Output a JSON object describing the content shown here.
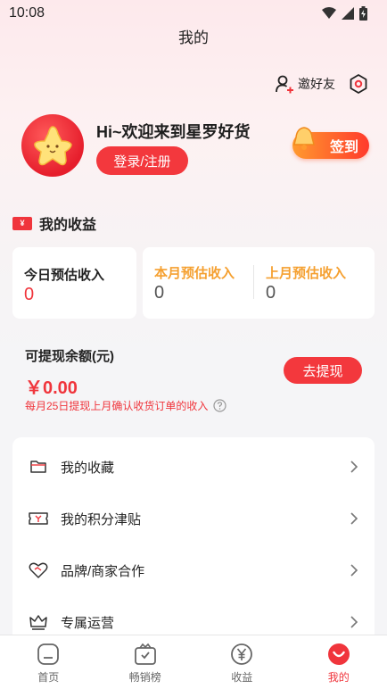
{
  "status_bar": {
    "time": "10:08"
  },
  "header": {
    "title": "我的",
    "invite_label": "邀好友"
  },
  "profile": {
    "greeting": "Hi~欢迎来到星罗好货",
    "login_label": "登录/注册",
    "signin_label": "签到"
  },
  "earnings": {
    "section_title": "我的收益",
    "badge_text": "¥",
    "today": {
      "label": "今日预估收入",
      "value": "0"
    },
    "this_month": {
      "label": "本月预估收入",
      "value": "0"
    },
    "last_month": {
      "label": "上月预估收入",
      "value": "0"
    }
  },
  "withdraw": {
    "title": "可提现余额(元)",
    "amount": "￥0.00",
    "note": "每月25日提现上月确认收货订单的收入",
    "button_label": "去提现"
  },
  "menu": {
    "items": [
      {
        "label": "我的收藏",
        "icon": "folder-icon"
      },
      {
        "label": "我的积分津贴",
        "icon": "ticket-icon"
      },
      {
        "label": "品牌/商家合作",
        "icon": "heart-handshake-icon"
      },
      {
        "label": "专属运营",
        "icon": "crown-icon"
      }
    ]
  },
  "tabbar": {
    "tabs": [
      {
        "label": "首页",
        "icon": "home-icon"
      },
      {
        "label": "畅销榜",
        "icon": "ranking-icon"
      },
      {
        "label": "收益",
        "icon": "yen-icon"
      },
      {
        "label": "我的",
        "icon": "smile-icon"
      }
    ],
    "active_index": 3
  },
  "colors": {
    "accent": "#f3383d",
    "orange": "#f5a030",
    "gray_value": "#555555"
  }
}
